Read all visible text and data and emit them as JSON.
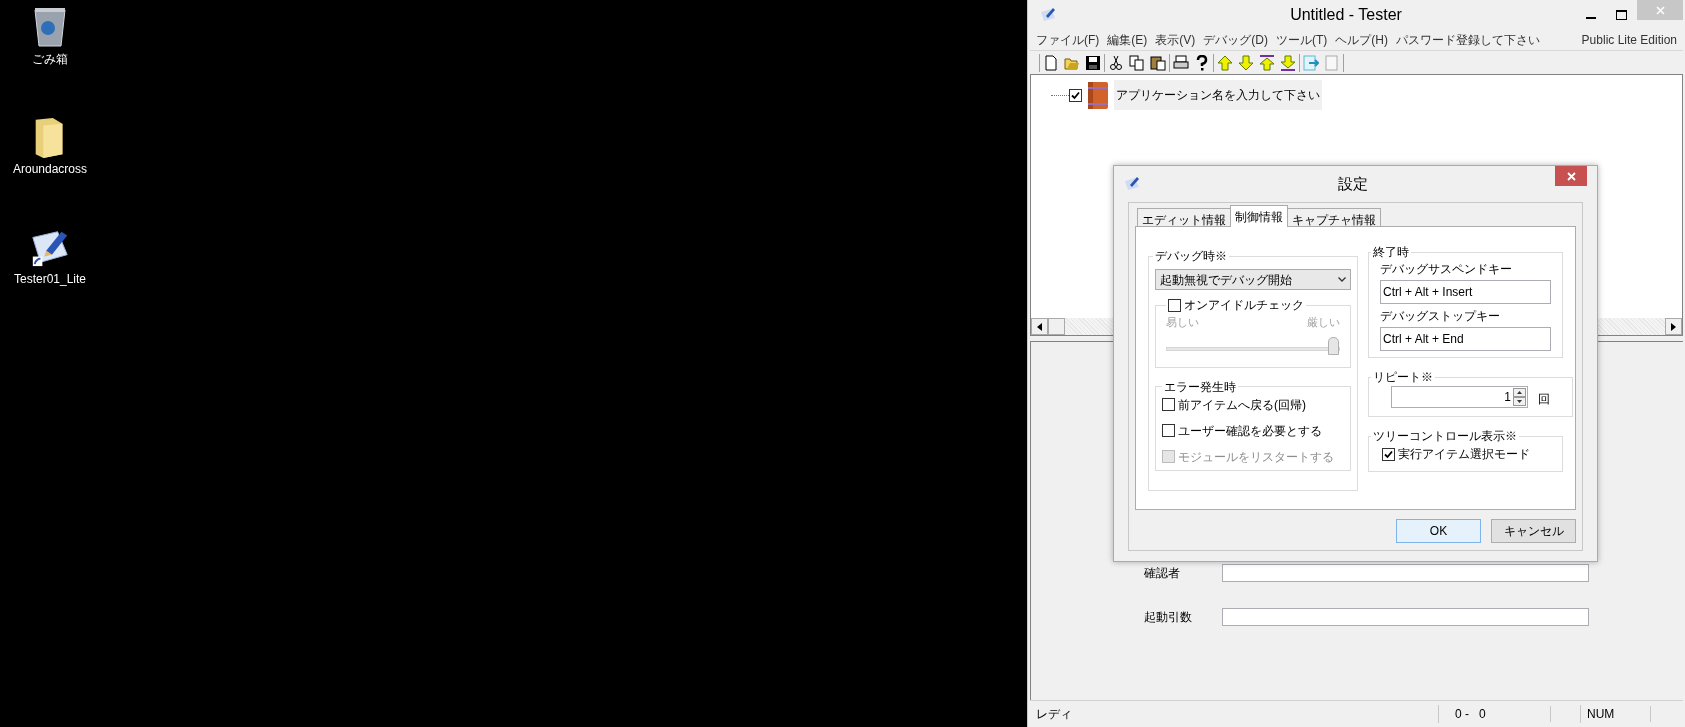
{
  "desktop": {
    "icons": [
      {
        "kind": "trash",
        "label": "ごみ箱"
      },
      {
        "kind": "folder",
        "label": "Aroundacross"
      },
      {
        "kind": "app",
        "label": "Tester01_Lite"
      }
    ]
  },
  "window": {
    "title": "Untitled - Tester",
    "menu": [
      "ファイル(F)",
      "編集(E)",
      "表示(V)",
      "デバッグ(D)",
      "ツール(T)",
      "ヘルプ(H)",
      "パスワード登録して下さい"
    ],
    "edition": "Public Lite Edition",
    "tree": [
      {
        "label": "アプリケーション名を入力して下さい",
        "checked": true
      }
    ],
    "fields": [
      {
        "label": "確認者"
      },
      {
        "label": "起動引数"
      }
    ],
    "status_bar": [
      "レディ",
      "0 -   0",
      "NUM"
    ]
  },
  "dialog": {
    "title": "設定",
    "tabs": [
      {
        "label": "エディット情報",
        "selected": false
      },
      {
        "label": "制御情報",
        "selected": true
      },
      {
        "label": "キャプチャ情報",
        "selected": false
      }
    ],
    "debug": {
      "title": "デバッグ時※",
      "mode": "起動無視でデバッグ開始",
      "idle_check": {
        "label": "オンアイドルチェック",
        "checked": false
      },
      "slider": {
        "min_label": "易しい",
        "max_label": "厳しい",
        "level": 1,
        "disabled": true
      }
    },
    "on_error": {
      "title": "エラー発生時",
      "options": [
        {
          "label": "前アイテムへ戻る(回帰)",
          "checked": false,
          "disabled": false
        },
        {
          "label": "ユーザー確認を必要とする",
          "checked": false,
          "disabled": false
        },
        {
          "label": "モジュールをリスタートする",
          "checked": false,
          "disabled": true
        }
      ]
    },
    "on_exit": {
      "title": "終了時",
      "keys": [
        {
          "label": "デバッグサスペンドキー",
          "value": "Ctrl + Alt + Insert"
        },
        {
          "label": "デバッグストップキー",
          "value": "Ctrl + Alt + End"
        }
      ]
    },
    "repeat": {
      "title": "リピート※",
      "value": "1",
      "unit": "回"
    },
    "tree_display": {
      "title": "ツリーコントロール表示※",
      "option": {
        "label": "実行アイテム選択モード",
        "checked": true
      }
    },
    "buttons": [
      {
        "label": "OK",
        "kind": "default"
      },
      {
        "label": "キャンセル",
        "kind": "normal"
      }
    ]
  }
}
